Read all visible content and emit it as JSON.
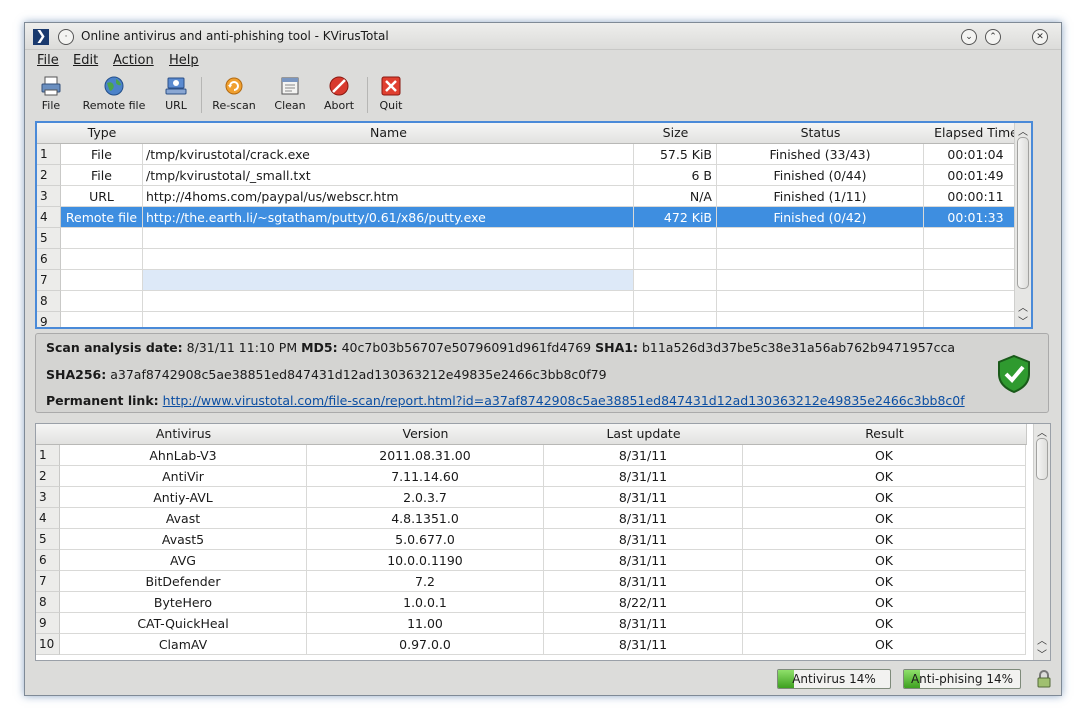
{
  "window": {
    "title": "Online antivirus and anti-phishing tool - KVirusTotal"
  },
  "menu": [
    "File",
    "Edit",
    "Action",
    "Help"
  ],
  "toolbar": [
    {
      "label": "File",
      "icon": "printer-icon"
    },
    {
      "label": "Remote file",
      "icon": "globe-icon"
    },
    {
      "label": "URL",
      "icon": "network-icon"
    },
    {
      "label": "Re-scan",
      "icon": "rescan-icon"
    },
    {
      "label": "Clean",
      "icon": "clean-icon"
    },
    {
      "label": "Abort",
      "icon": "abort-icon"
    },
    {
      "label": "Quit",
      "icon": "quit-icon"
    }
  ],
  "scan_table": {
    "headers": [
      "Type",
      "Name",
      "Size",
      "Status",
      "Elapsed Time"
    ],
    "rows": [
      {
        "num": "1",
        "type": "File",
        "name": "/tmp/kvirustotal/crack.exe",
        "size": "57.5 KiB",
        "status": "Finished (33/43)",
        "elapsed": "00:01:04"
      },
      {
        "num": "2",
        "type": "File",
        "name": "/tmp/kvirustotal/_small.txt",
        "size": "6 B",
        "status": "Finished (0/44)",
        "elapsed": "00:01:49"
      },
      {
        "num": "3",
        "type": "URL",
        "name": "http://4homs.com/paypal/us/webscr.htm",
        "size": "N/A",
        "status": "Finished (1/11)",
        "elapsed": "00:00:11"
      },
      {
        "num": "4",
        "type": "Remote file",
        "name": "http://the.earth.li/~sgtatham/putty/0.61/x86/putty.exe",
        "size": "472 KiB",
        "status": "Finished (0/42)",
        "elapsed": "00:01:33"
      },
      {
        "num": "5",
        "type": "",
        "name": "",
        "size": "",
        "status": "",
        "elapsed": ""
      },
      {
        "num": "6",
        "type": "",
        "name": "",
        "size": "",
        "status": "",
        "elapsed": ""
      },
      {
        "num": "7",
        "type": "",
        "name": "",
        "size": "",
        "status": "",
        "elapsed": ""
      },
      {
        "num": "8",
        "type": "",
        "name": "",
        "size": "",
        "status": "",
        "elapsed": ""
      },
      {
        "num": "9",
        "type": "",
        "name": "",
        "size": "",
        "status": "",
        "elapsed": ""
      }
    ],
    "selected_row": 3
  },
  "info": {
    "date_label": "Scan analysis date:",
    "date_value": "8/31/11 11:10 PM",
    "md5_label": "MD5:",
    "md5_value": "40c7b03b56707e50796091d961fd4769",
    "sha1_label": "SHA1:",
    "sha1_value": "b11a526d3d37be5c38e31a56ab762b9471957cca",
    "sha256_label": "SHA256:",
    "sha256_value": "a37af8742908c5ae38851ed847431d12ad130363212e49835e2466c3bb8c0f79",
    "permalink_label": "Permanent link:",
    "permalink_value": "http://www.virustotal.com/file-scan/report.html?id=a37af8742908c5ae38851ed847431d12ad130363212e49835e2466c3bb8c0f",
    "shield_icon": "shield-check-icon",
    "shield_color": "#2f9a2f"
  },
  "av_table": {
    "headers": [
      "Antivirus",
      "Version",
      "Last update",
      "Result"
    ],
    "rows": [
      {
        "num": "1",
        "antivirus": "AhnLab-V3",
        "version": "2011.08.31.00",
        "update": "8/31/11",
        "result": "OK"
      },
      {
        "num": "2",
        "antivirus": "AntiVir",
        "version": "7.11.14.60",
        "update": "8/31/11",
        "result": "OK"
      },
      {
        "num": "3",
        "antivirus": "Antiy-AVL",
        "version": "2.0.3.7",
        "update": "8/31/11",
        "result": "OK"
      },
      {
        "num": "4",
        "antivirus": "Avast",
        "version": "4.8.1351.0",
        "update": "8/31/11",
        "result": "OK"
      },
      {
        "num": "5",
        "antivirus": "Avast5",
        "version": "5.0.677.0",
        "update": "8/31/11",
        "result": "OK"
      },
      {
        "num": "6",
        "antivirus": "AVG",
        "version": "10.0.0.1190",
        "update": "8/31/11",
        "result": "OK"
      },
      {
        "num": "7",
        "antivirus": "BitDefender",
        "version": "7.2",
        "update": "8/31/11",
        "result": "OK"
      },
      {
        "num": "8",
        "antivirus": "ByteHero",
        "version": "1.0.0.1",
        "update": "8/22/11",
        "result": "OK"
      },
      {
        "num": "9",
        "antivirus": "CAT-QuickHeal",
        "version": "11.00",
        "update": "8/31/11",
        "result": "OK"
      },
      {
        "num": "10",
        "antivirus": "ClamAV",
        "version": "0.97.0.0",
        "update": "8/31/11",
        "result": "OK"
      }
    ]
  },
  "status": {
    "antivirus_text": "Antivirus 14%",
    "antivirus_progress": 14,
    "antiphishing_text": "Anti-phising 14%",
    "antiphishing_progress": 14,
    "progress_color": "#3ea020"
  }
}
